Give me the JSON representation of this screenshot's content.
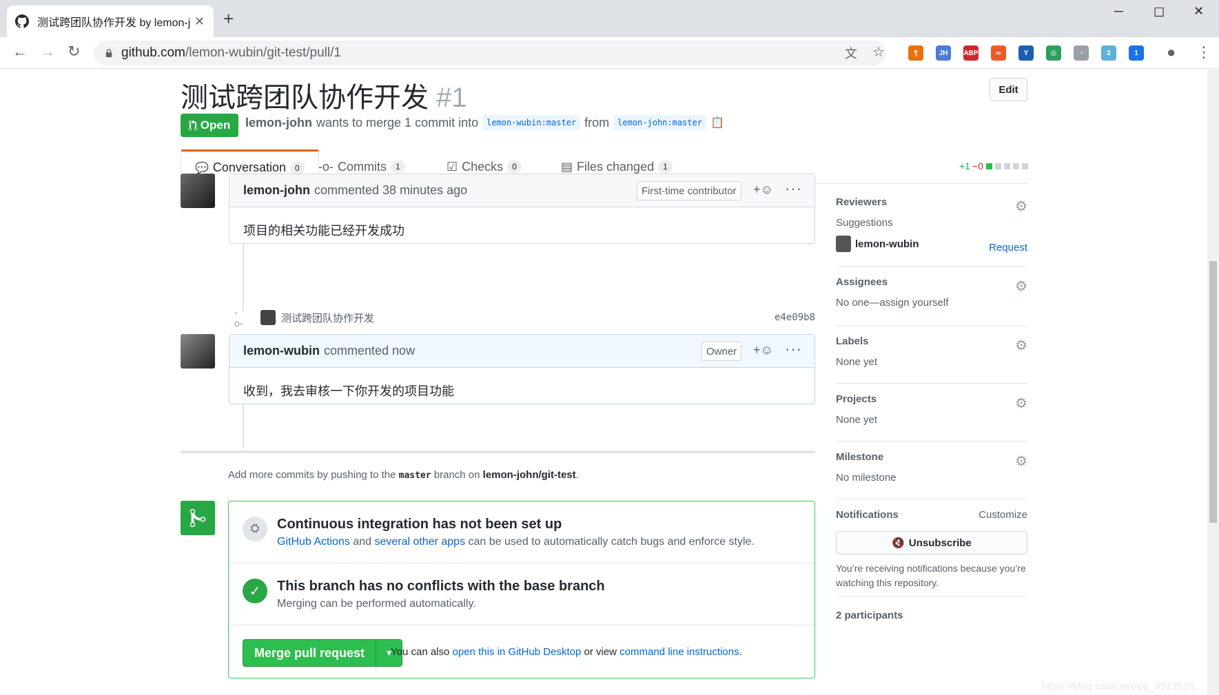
{
  "browser": {
    "tab_title": "测试跨团队协作开发 by lemon-j",
    "url_host": "github.com",
    "url_path": "/lemon-wubin/git-test/pull/1",
    "extensions": [
      {
        "name": "pilcrow-icon",
        "label": "¶",
        "color": "#e8710a"
      },
      {
        "name": "jh-extension-icon",
        "label": "JH",
        "color": "#4a7cdb"
      },
      {
        "name": "adblock-plus-icon",
        "label": "ABP",
        "color": "#d2262b"
      },
      {
        "name": "infinity-extension-icon",
        "label": "∞",
        "color": "#f05a28"
      },
      {
        "name": "v-extension-icon",
        "label": "Y",
        "color": "#1a5fb4"
      },
      {
        "name": "green-ring-extension-icon",
        "label": "◎",
        "color": "#2ca05a"
      },
      {
        "name": "gauge-extension-icon",
        "label": "◔",
        "color": "#9aa0a6"
      },
      {
        "name": "badge-2-extension-icon",
        "label": "2",
        "color": "#5db1d5"
      },
      {
        "name": "badge-1-extension-icon",
        "label": "1",
        "color": "#1a73e8"
      }
    ]
  },
  "pr": {
    "title": "测试跨团队协作开发",
    "number": "#1",
    "edit_label": "Edit",
    "state": "Open",
    "author": "lemon-john",
    "merge_text": "wants to merge 1 commit into",
    "base_branch": "lemon-wubin:master",
    "from_text": "from",
    "head_branch": "lemon-john:master"
  },
  "tabs": [
    {
      "label": "Conversation",
      "count": "0"
    },
    {
      "label": "Commits",
      "count": "1"
    },
    {
      "label": "Checks",
      "count": "0"
    },
    {
      "label": "Files changed",
      "count": "1"
    }
  ],
  "diffstat": {
    "added": "+1",
    "removed": "−0"
  },
  "comments": [
    {
      "author": "lemon-john",
      "action": "commented 38 minutes ago",
      "badge": "First-time contributor",
      "body": "项目的相关功能已经开发成功"
    },
    {
      "author": "lemon-wubin",
      "action": "commented now",
      "badge": "Owner",
      "body": "收到，我去审核一下你开发的项目功能"
    }
  ],
  "commit": {
    "message": "测试跨团队协作开发",
    "sha": "e4e09b8"
  },
  "push_hint": {
    "prefix": "Add more commits by pushing to the",
    "branch": "master",
    "middle": "branch on",
    "repo": "lemon-john/git-test",
    "suffix": "."
  },
  "merge": {
    "ci_title": "Continuous integration has not been set up",
    "ci_link1": "GitHub Actions",
    "ci_and": "and",
    "ci_link2": "several other apps",
    "ci_rest": "can be used to automatically catch bugs and enforce style.",
    "conflict_title": "This branch has no conflicts with the base branch",
    "conflict_desc": "Merging can be performed automatically.",
    "button_label": "Merge pull request",
    "alt_prefix": "You can also",
    "alt_link1": "open this in GitHub Desktop",
    "alt_mid": "or view",
    "alt_link2": "command line instructions",
    "alt_suffix": "."
  },
  "sidebar": {
    "reviewers": {
      "title": "Reviewers",
      "suggestions": "Suggestions",
      "user": "lemon-wubin",
      "request": "Request"
    },
    "assignees": {
      "title": "Assignees",
      "value": "No one—assign yourself"
    },
    "labels": {
      "title": "Labels",
      "value": "None yet"
    },
    "projects": {
      "title": "Projects",
      "value": "None yet"
    },
    "milestone": {
      "title": "Milestone",
      "value": "No milestone"
    },
    "notifications": {
      "title": "Notifications",
      "customize": "Customize",
      "unsubscribe": "Unsubscribe",
      "note": "You’re receiving notifications because you’re watching this repository."
    },
    "participants": "2 participants"
  },
  "watermark": "https://blog.csdn.net/qq_3913528..."
}
